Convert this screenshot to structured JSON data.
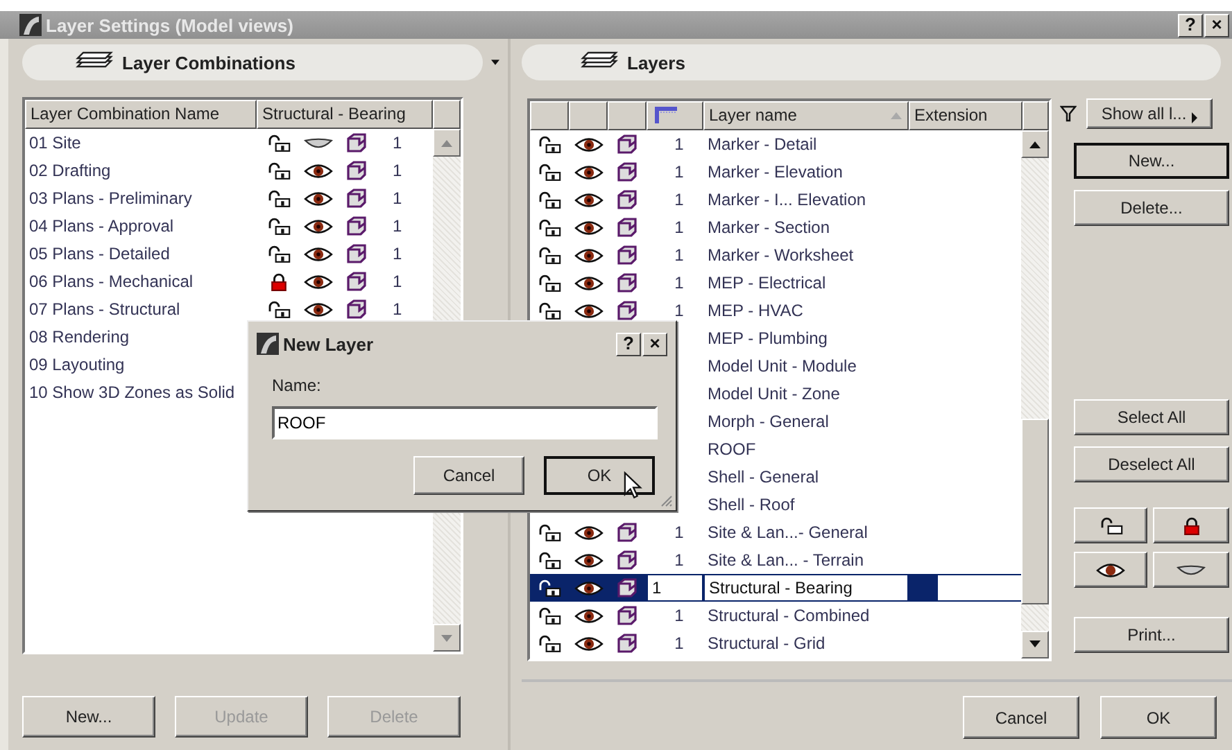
{
  "window": {
    "title": "Layer Settings (Model views)",
    "help": "?",
    "close": "×"
  },
  "combinations": {
    "title": "Layer Combinations",
    "columns": [
      "Layer Combination Name",
      "Structural - Bearing"
    ],
    "rows": [
      {
        "name": "01 Site",
        "locked": false,
        "visible": false,
        "pen": "1"
      },
      {
        "name": "02 Drafting",
        "locked": false,
        "visible": true,
        "pen": "1"
      },
      {
        "name": "03 Plans - Preliminary",
        "locked": false,
        "visible": true,
        "pen": "1"
      },
      {
        "name": "04 Plans - Approval",
        "locked": false,
        "visible": true,
        "pen": "1"
      },
      {
        "name": "05 Plans - Detailed",
        "locked": false,
        "visible": true,
        "pen": "1"
      },
      {
        "name": "06 Plans - Mechanical",
        "locked": true,
        "visible": true,
        "pen": "1"
      },
      {
        "name": "07 Plans - Structural",
        "locked": false,
        "visible": true,
        "pen": "1"
      },
      {
        "name": "08 Rendering"
      },
      {
        "name": "09 Layouting"
      },
      {
        "name": "10 Show 3D Zones as Solid"
      }
    ],
    "buttons": [
      {
        "label": "New...",
        "disabled": false
      },
      {
        "label": "Update",
        "disabled": true
      },
      {
        "label": "Delete",
        "disabled": true
      }
    ]
  },
  "layers": {
    "title": "Layers",
    "columns": [
      "Layer name",
      "Extension"
    ],
    "rows": [
      {
        "name": "Marker - Detail",
        "locked": false,
        "visible": true,
        "pen": "1",
        "selected": false
      },
      {
        "name": "Marker - Elevation",
        "locked": false,
        "visible": true,
        "pen": "1",
        "selected": false
      },
      {
        "name": "Marker - I... Elevation",
        "locked": false,
        "visible": true,
        "pen": "1",
        "selected": false
      },
      {
        "name": "Marker - Section",
        "locked": false,
        "visible": true,
        "pen": "1",
        "selected": false
      },
      {
        "name": "Marker - Worksheet",
        "locked": false,
        "visible": true,
        "pen": "1",
        "selected": false
      },
      {
        "name": "MEP - Electrical",
        "locked": false,
        "visible": true,
        "pen": "1",
        "selected": false
      },
      {
        "name": "MEP - HVAC",
        "locked": false,
        "visible": true,
        "pen": "1",
        "selected": false
      },
      {
        "name": "MEP - Plumbing",
        "selected": false
      },
      {
        "name": "Model Unit - Module",
        "selected": false
      },
      {
        "name": "Model Unit - Zone",
        "selected": false
      },
      {
        "name": "Morph - General",
        "selected": false
      },
      {
        "name": "ROOF",
        "selected": false
      },
      {
        "name": "Shell - General",
        "selected": false
      },
      {
        "name": "Shell - Roof",
        "selected": false
      },
      {
        "name": "Site & Lan...- General",
        "locked": false,
        "visible": true,
        "pen": "1",
        "selected": false
      },
      {
        "name": "Site & Lan... - Terrain",
        "locked": false,
        "visible": true,
        "pen": "1",
        "selected": false
      },
      {
        "name": "Structural - Bearing",
        "locked": false,
        "visible": true,
        "pen": "1",
        "selected": true
      },
      {
        "name": "Structural - Combined",
        "locked": false,
        "visible": true,
        "pen": "1",
        "selected": false
      },
      {
        "name": "Structural - Grid",
        "locked": false,
        "visible": true,
        "pen": "1",
        "selected": false
      }
    ]
  },
  "side": {
    "filter": "Show all l...",
    "buttons": [
      {
        "label": "New...",
        "default": true
      },
      {
        "label": "Delete...",
        "default": false
      }
    ],
    "select_buttons": [
      "Select All",
      "Deselect All"
    ],
    "print": "Print..."
  },
  "footer_buttons": [
    "Cancel",
    "OK"
  ],
  "dialog": {
    "title": "New Layer",
    "help": "?",
    "close": "×",
    "label": "Name:",
    "value": "ROOF",
    "buttons": [
      {
        "label": "Cancel",
        "default": false
      },
      {
        "label": "OK",
        "default": true
      }
    ]
  }
}
